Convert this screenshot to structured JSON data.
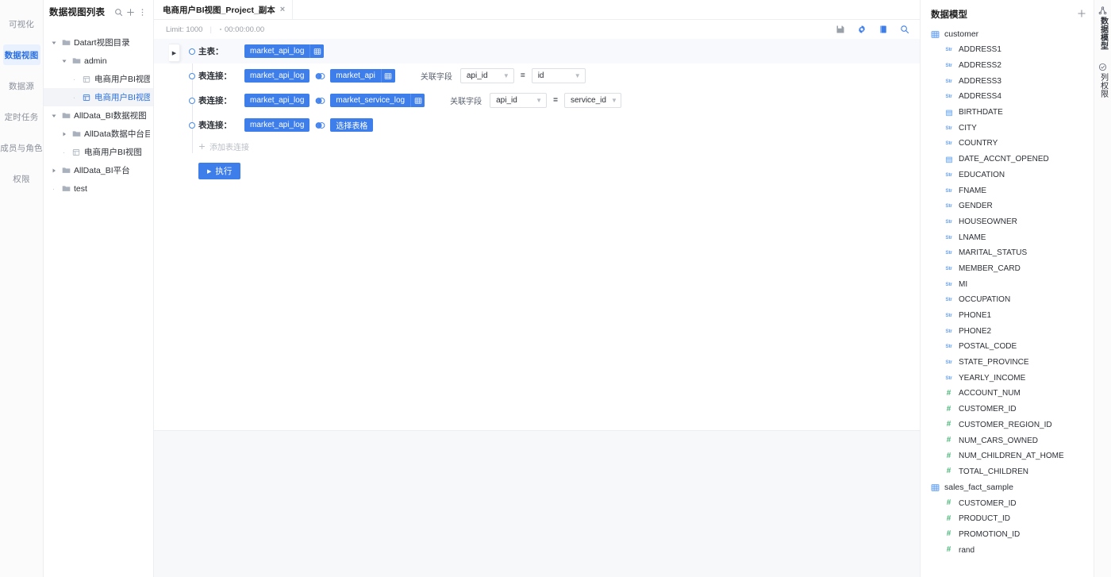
{
  "nav": {
    "items": [
      {
        "label": "可视化",
        "active": false
      },
      {
        "label": "数据视图",
        "active": true
      },
      {
        "label": "数据源",
        "active": false
      },
      {
        "label": "定时任务",
        "active": false
      },
      {
        "label": "成员与角色",
        "active": false
      },
      {
        "label": "权限",
        "active": false
      }
    ]
  },
  "list_panel": {
    "title": "数据视图列表",
    "search_icon": "search-icon",
    "add_icon": "plus-icon",
    "more_icon": "more-icon",
    "tree": [
      {
        "label": "Datart视图目录",
        "indent": 0,
        "caret": "down",
        "icon": "folder-icon",
        "selected": false
      },
      {
        "label": "admin",
        "indent": 1,
        "caret": "down",
        "icon": "folder-icon",
        "selected": false
      },
      {
        "label": "电商用户BI视图_Project",
        "indent": 2,
        "caret": "none",
        "icon": "view-icon",
        "selected": false
      },
      {
        "label": "电商用户BI视图_Project_副本",
        "indent": 2,
        "caret": "none",
        "icon": "view-icon-active",
        "selected": true
      },
      {
        "label": "AllData_BI数据视图",
        "indent": 0,
        "caret": "down",
        "icon": "folder-icon",
        "selected": false
      },
      {
        "label": "AllData数据中台目录",
        "indent": 1,
        "caret": "right",
        "icon": "folder-icon",
        "selected": false
      },
      {
        "label": "电商用户BI视图",
        "indent": 1,
        "caret": "none",
        "icon": "view-icon",
        "selected": false
      },
      {
        "label": "AllData_BI平台",
        "indent": 0,
        "caret": "right",
        "icon": "folder-icon",
        "selected": false
      },
      {
        "label": "test",
        "indent": 0,
        "caret": "none",
        "icon": "folder-icon",
        "selected": false
      }
    ]
  },
  "tabs": [
    {
      "label": "电商用户BI视图_Project_副本",
      "close": "×",
      "active": true
    }
  ],
  "toolbar": {
    "limit": "Limit: 1000",
    "separator": "|",
    "duration": "00:00:00.00",
    "icons": [
      {
        "name": "save-icon",
        "color": "#9aa0a8"
      },
      {
        "name": "gear-icon",
        "color": "#3d7eeb"
      },
      {
        "name": "book-icon",
        "color": "#3d7eeb"
      },
      {
        "name": "search-zoom-icon",
        "color": "#3d7eeb"
      }
    ]
  },
  "builder": {
    "main_table_label": "主表：",
    "join_label": "表连接：",
    "relation_field_label": "关联字段",
    "equals": "=",
    "select_table_label": "选择表格",
    "add_join_label": "添加表连接",
    "add_join_icon": "plus-icon",
    "execute_label": "执行",
    "execute_icon": "play-icon",
    "expand_handle_icon": "triangle-right-icon",
    "rows": [
      {
        "type": "main",
        "label": "主表：",
        "left_table": "market_api_log",
        "left_icon": "table-icon",
        "has_join": false
      },
      {
        "type": "join",
        "label": "表连接：",
        "left_table": "market_api_log",
        "left_icon": "none",
        "join_icon": "venn-join-icon",
        "right_table": "market_api",
        "right_icon": "table-icon",
        "relation_label": "关联字段",
        "left_field": "api_id",
        "equals": "=",
        "right_field": "id"
      },
      {
        "type": "join",
        "label": "表连接：",
        "left_table": "market_api_log",
        "left_icon": "none",
        "join_icon": "venn-join-icon",
        "right_table": "market_service_log",
        "right_icon": "table-icon",
        "relation_label": "关联字段",
        "left_field": "api_id",
        "equals": "=",
        "right_field": "service_id"
      },
      {
        "type": "join-empty",
        "label": "表连接：",
        "left_table": "market_api_log",
        "left_icon": "none",
        "join_icon": "venn-join-icon",
        "right_table": "选择表格",
        "right_icon": "none"
      }
    ]
  },
  "model_panel": {
    "title": "数据模型",
    "add_icon": "plus-icon",
    "tables": [
      {
        "name": "customer",
        "icon": "table-grid-icon",
        "fields": [
          {
            "name": "ADDRESS1",
            "type": "STR"
          },
          {
            "name": "ADDRESS2",
            "type": "STR"
          },
          {
            "name": "ADDRESS3",
            "type": "STR"
          },
          {
            "name": "ADDRESS4",
            "type": "STR"
          },
          {
            "name": "BIRTHDATE",
            "type": "DATE"
          },
          {
            "name": "CITY",
            "type": "STR"
          },
          {
            "name": "COUNTRY",
            "type": "STR"
          },
          {
            "name": "DATE_ACCNT_OPENED",
            "type": "DATE"
          },
          {
            "name": "EDUCATION",
            "type": "STR"
          },
          {
            "name": "FNAME",
            "type": "STR"
          },
          {
            "name": "GENDER",
            "type": "STR"
          },
          {
            "name": "HOUSEOWNER",
            "type": "STR"
          },
          {
            "name": "LNAME",
            "type": "STR"
          },
          {
            "name": "MARITAL_STATUS",
            "type": "STR"
          },
          {
            "name": "MEMBER_CARD",
            "type": "STR"
          },
          {
            "name": "MI",
            "type": "STR"
          },
          {
            "name": "OCCUPATION",
            "type": "STR"
          },
          {
            "name": "PHONE1",
            "type": "STR"
          },
          {
            "name": "PHONE2",
            "type": "STR"
          },
          {
            "name": "POSTAL_CODE",
            "type": "STR"
          },
          {
            "name": "STATE_PROVINCE",
            "type": "STR"
          },
          {
            "name": "YEARLY_INCOME",
            "type": "STR"
          },
          {
            "name": "ACCOUNT_NUM",
            "type": "NUM"
          },
          {
            "name": "CUSTOMER_ID",
            "type": "NUM"
          },
          {
            "name": "CUSTOMER_REGION_ID",
            "type": "NUM"
          },
          {
            "name": "NUM_CARS_OWNED",
            "type": "NUM"
          },
          {
            "name": "NUM_CHILDREN_AT_HOME",
            "type": "NUM"
          },
          {
            "name": "TOTAL_CHILDREN",
            "type": "NUM"
          }
        ]
      },
      {
        "name": "sales_fact_sample",
        "icon": "table-grid-icon",
        "fields": [
          {
            "name": "CUSTOMER_ID",
            "type": "NUM"
          },
          {
            "name": "PRODUCT_ID",
            "type": "NUM"
          },
          {
            "name": "PROMOTION_ID",
            "type": "NUM"
          },
          {
            "name": "rand",
            "type": "NUM"
          }
        ]
      }
    ]
  },
  "vtabs": [
    {
      "label": "数据模型",
      "icon": "model-node-icon",
      "active": true
    },
    {
      "label": "列权限",
      "icon": "check-circle-icon",
      "active": false
    }
  ],
  "colors": {
    "accent": "#3d7eeb",
    "tag": "#3d7eeb",
    "active_nav_bg": "#e8f1fd",
    "active_nav_text": "#2b6fe0",
    "str_icon": "#6ba3ef",
    "num_icon": "#4cb87a",
    "panel_bg": "#fbfbfc",
    "border": "#eceef1"
  }
}
